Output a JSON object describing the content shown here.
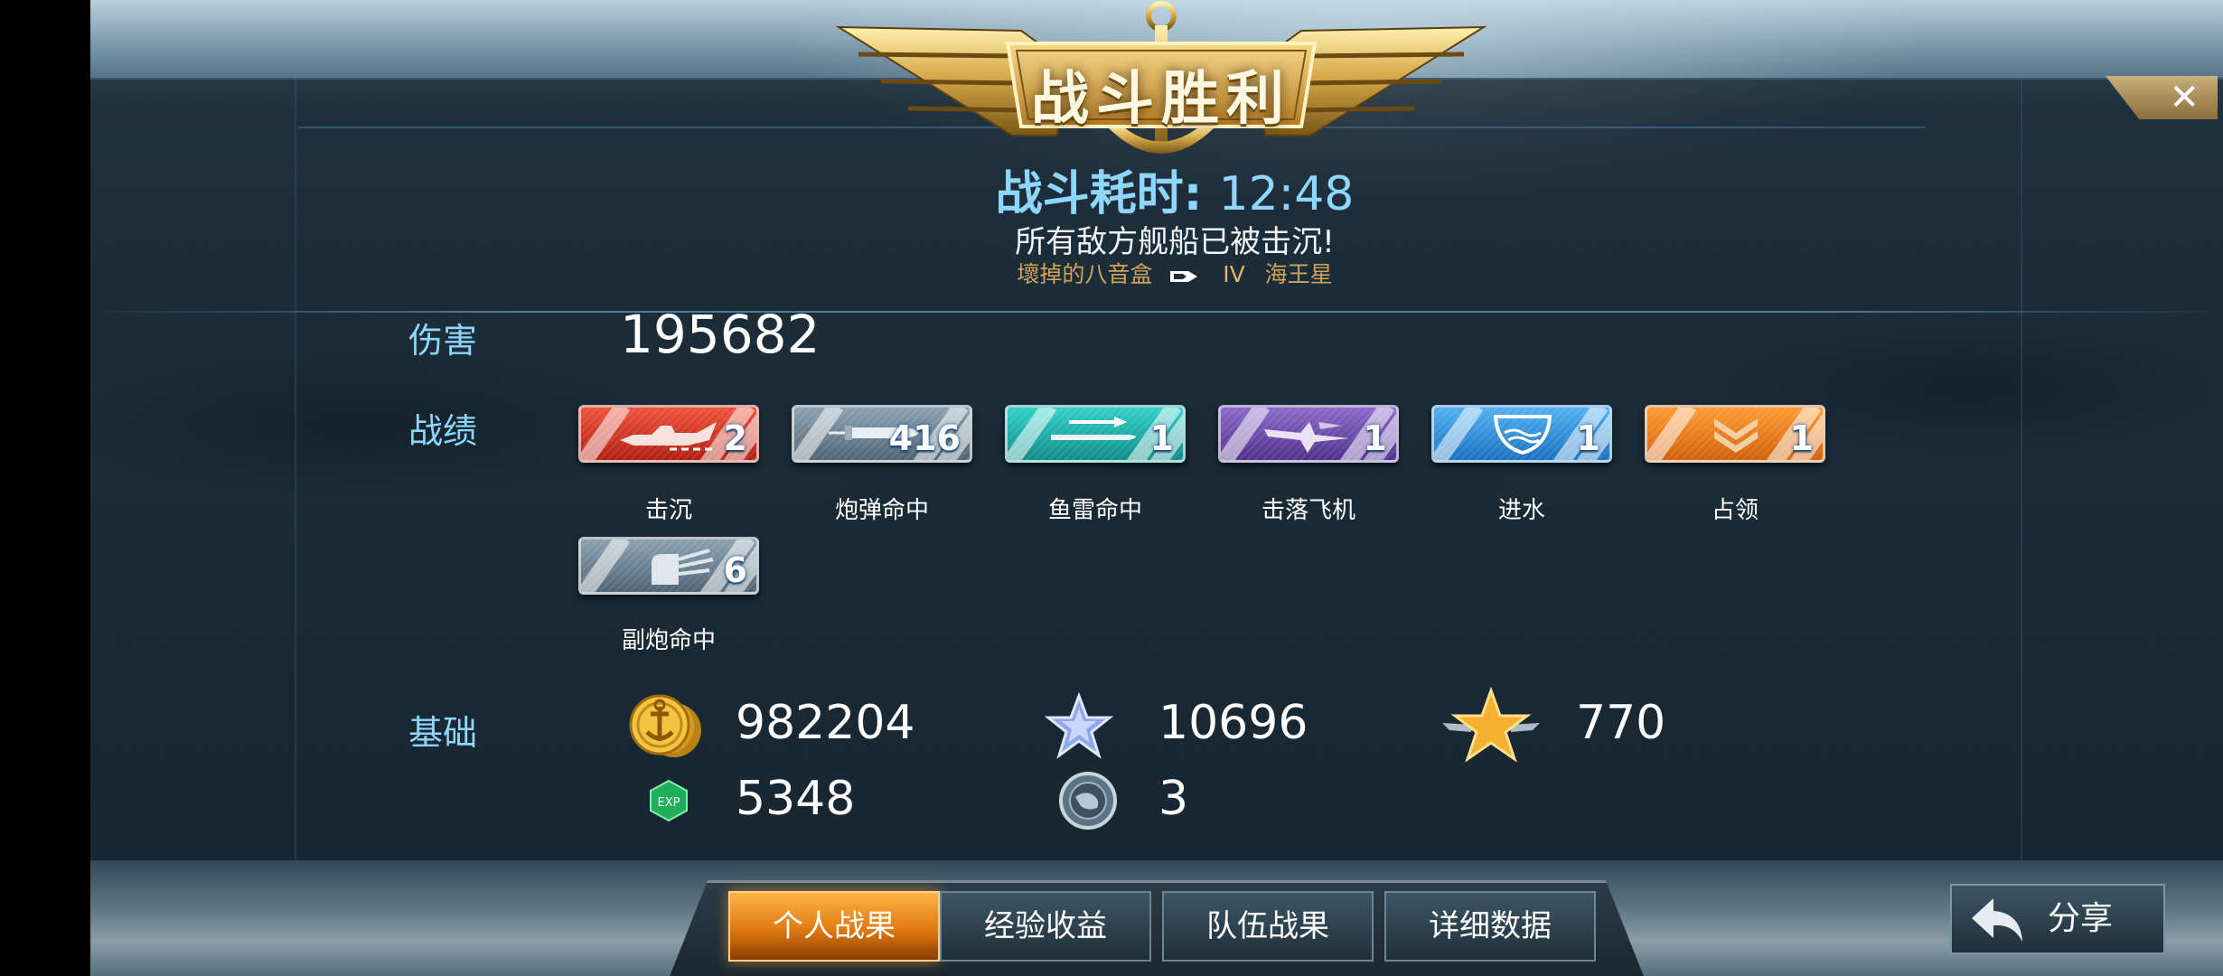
{
  "header": {
    "title": "战斗胜利",
    "close_label": "✕",
    "time_label": "战斗耗时:",
    "time_value": "12:48",
    "message": "所有敌方舰船已被击沉!",
    "player_a": "壞掉的八音盒",
    "rank": "IV",
    "player_b": "海王星"
  },
  "damage": {
    "label": "伤害",
    "value": "195682"
  },
  "record": {
    "label": "战绩",
    "medals": [
      {
        "name": "击沉",
        "count": "2",
        "color": "#d8301e",
        "icon": "ship-icon"
      },
      {
        "name": "炮弹命中",
        "count": "416",
        "color": "#6f8596",
        "icon": "shell-icon"
      },
      {
        "name": "鱼雷命中",
        "count": "1",
        "color": "#17a8a4",
        "icon": "torpedo-icon"
      },
      {
        "name": "击落飞机",
        "count": "1",
        "color": "#6a4aa6",
        "icon": "plane-icon"
      },
      {
        "name": "进水",
        "count": "1",
        "color": "#2a8ed8",
        "icon": "flood-icon"
      },
      {
        "name": "占领",
        "count": "1",
        "color": "#f07a10",
        "icon": "capture-icon"
      },
      {
        "name": "副炮命中",
        "count": "6",
        "color": "#6f8596",
        "icon": "secondary-gun-icon"
      }
    ]
  },
  "basic": {
    "label": "基础",
    "silver": "982204",
    "star_exp": "10696",
    "gold_star": "770",
    "exp": "5348",
    "globe": "3"
  },
  "tabs": [
    {
      "label": "个人战果",
      "active": true
    },
    {
      "label": "经验收益",
      "active": false
    },
    {
      "label": "队伍战果",
      "active": false
    },
    {
      "label": "详细数据",
      "active": false
    }
  ],
  "share_label": "分享"
}
